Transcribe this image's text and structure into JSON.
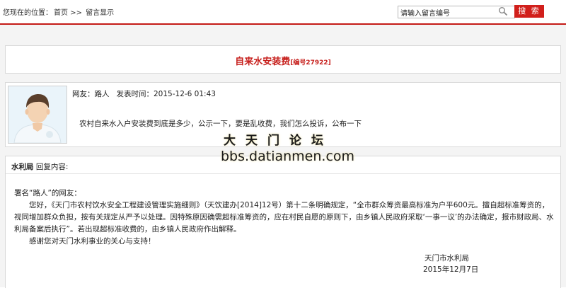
{
  "breadcrumb": {
    "prefix": "您现在的位置：",
    "home": "首页",
    "separator": ">>",
    "current": "留言显示"
  },
  "search": {
    "value": "请输入留言编号",
    "button_label": "搜 索",
    "icon": "magnifier-icon"
  },
  "post": {
    "title": "自来水安装费",
    "number_label": "[编号27922]",
    "user_label": "网友：路人",
    "time_label": "发表时间：2015-12-6 01:43",
    "question": "农村自来水入户安装费到底是多少，公示一下，要是乱收费，我们怎么投诉，公布一下"
  },
  "watermark": {
    "name": "大天门论坛",
    "url": "bbs.datianmen.com"
  },
  "reply": {
    "author": "水利局",
    "label": "回复内容:",
    "greeting": "署名“路人”的网友：",
    "paragraph1": "您好，《天门市农村饮水安全工程建设管理实施细则》（天饮建办[2014]12号）第十二条明确规定，“全市群众筹资最高标准为户平600元。擅自超标准筹资的，视同增加群众负担，按有关规定从严予以处理。因特殊原因确需超标准筹资的，应在村民自愿的原则下，由乡镇人民政府采取‘一事一议’的办法确定，报市财政局、水利局备案后执行”。若出现超标准收费的，由乡镇人民政府作出解释。",
    "paragraph2": "感谢您对天门水利事业的关心与支持！",
    "signature_org": "天门市水利局",
    "signature_date": "2015年12月7日"
  },
  "colors": {
    "accent_red": "#c7201d",
    "button_red": "#d11f1b"
  }
}
